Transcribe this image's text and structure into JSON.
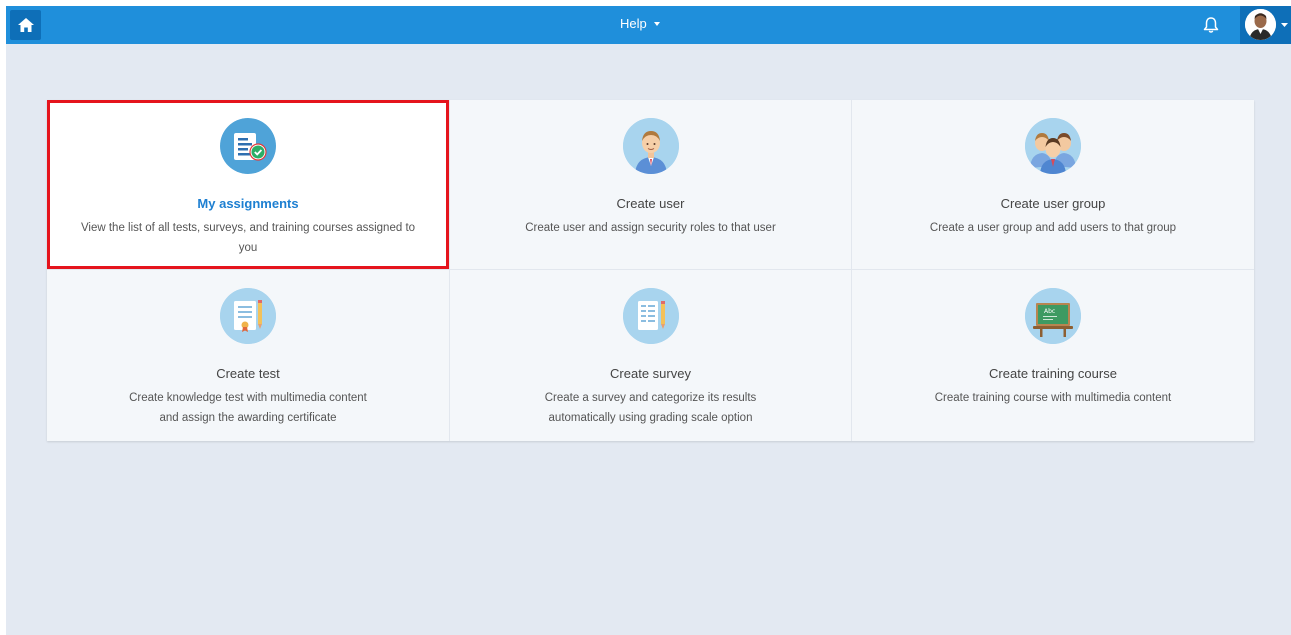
{
  "topbar": {
    "help_label": "Help",
    "icons": {
      "home": "home-icon",
      "bell": "bell-icon",
      "avatar": "user-avatar"
    }
  },
  "colors": {
    "topbar": "#1f8fdb",
    "topbar_dark": "#0e6fb8",
    "page_bg": "#e3e9f2",
    "active_title": "#1d7fd1",
    "highlight_border": "#e5141d"
  },
  "tiles": [
    {
      "title": "My assignments",
      "desc_lines": [
        "View the list of all tests, surveys, and training courses assigned to",
        "you"
      ],
      "icon": "assignments-icon",
      "selected": true
    },
    {
      "title": "Create user",
      "desc_lines": [
        "Create user and assign security roles to that user"
      ],
      "icon": "user-icon",
      "selected": false
    },
    {
      "title": "Create user group",
      "desc_lines": [
        "Create a user group and add users to that group"
      ],
      "icon": "user-group-icon",
      "selected": false
    },
    {
      "title": "Create test",
      "desc_lines": [
        "Create knowledge test with multimedia content",
        "and assign the awarding certificate"
      ],
      "icon": "certificate-icon",
      "selected": false
    },
    {
      "title": "Create survey",
      "desc_lines": [
        "Create a survey and categorize its results",
        "automatically using grading scale option"
      ],
      "icon": "survey-icon",
      "selected": false
    },
    {
      "title": "Create training course",
      "desc_lines": [
        "Create training course with multimedia content"
      ],
      "icon": "chalkboard-icon",
      "selected": false,
      "icon_text": "Abc"
    }
  ]
}
